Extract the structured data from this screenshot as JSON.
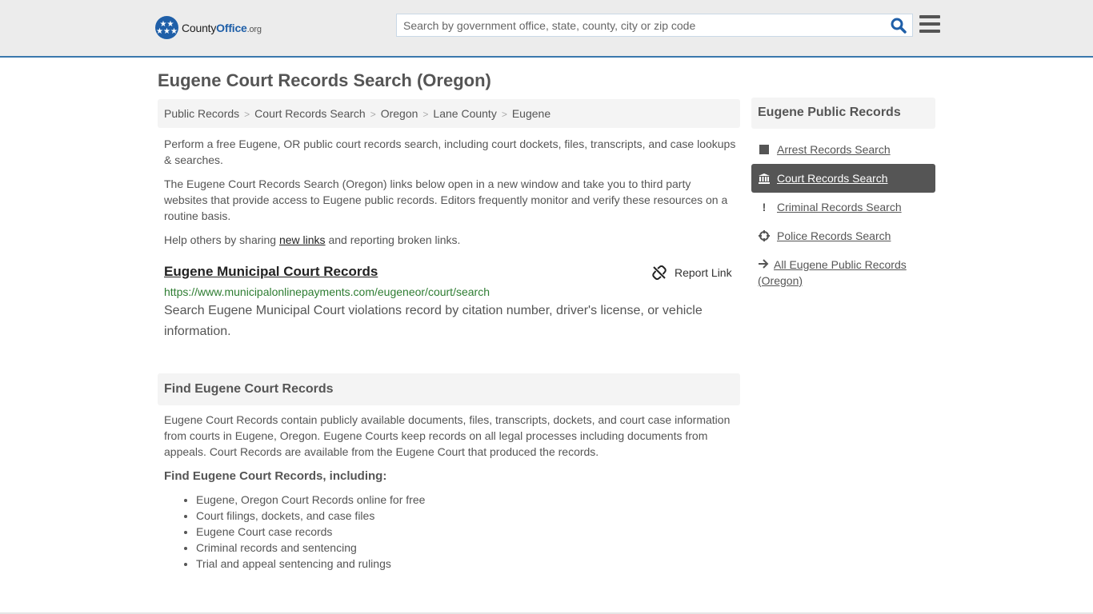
{
  "header": {
    "logo": {
      "part1": "County",
      "part2": "Office",
      "part3": ".org"
    },
    "search_placeholder": "Search by government office, state, county, city or zip code",
    "search_value": "",
    "search_icon": "search-icon",
    "menu_icon": "hamburger-icon",
    "accent_color": "#3b78ad"
  },
  "page": {
    "title": "Eugene Court Records Search (Oregon)",
    "breadcrumb": [
      "Public Records",
      "Court Records Search",
      "Oregon",
      "Lane County",
      "Eugene"
    ],
    "intro_1": "Perform a free Eugene, OR public court records search, including court dockets, files, transcripts, and case lookups & searches.",
    "intro_2": "The Eugene Court Records Search (Oregon) links below open in a new window and take you to third party websites that provide access to Eugene public records. Editors frequently monitor and verify these resources on a routine basis.",
    "intro_3_before": "Help others by sharing ",
    "intro_3_link": "new links",
    "intro_3_after": " and reporting broken links."
  },
  "links": [
    {
      "title": "Eugene Municipal Court Records",
      "url": "https://www.municipalonlinepayments.com/eugeneor/court/search",
      "description": "Search Eugene Municipal Court violations record by citation number, driver's license, or vehicle information.",
      "report_label": "Report Link"
    }
  ],
  "find_section": {
    "heading": "Find Eugene Court Records",
    "body": "Eugene Court Records contain publicly available documents, files, transcripts, dockets, and court case information from courts in Eugene, Oregon. Eugene Courts keep records on all legal processes including documents from appeals. Court Records are available from the Eugene Court that produced the records.",
    "subheading": "Find Eugene Court Records, including:",
    "bullets": [
      "Eugene, Oregon Court Records online for free",
      "Court filings, dockets, and case files",
      "Eugene Court case records",
      "Criminal records and sentencing",
      "Trial and appeal sentencing and rulings"
    ]
  },
  "sidebar": {
    "heading": "Eugene Public Records",
    "items": [
      {
        "label": "Arrest Records Search",
        "icon": "square-icon",
        "active": false
      },
      {
        "label": "Court Records Search",
        "icon": "courthouse-icon",
        "active": true
      },
      {
        "label": "Criminal Records Search",
        "icon": "exclamation-icon",
        "active": false
      },
      {
        "label": "Police Records Search",
        "icon": "crosshair-icon",
        "active": false
      },
      {
        "label": "All Eugene Public Records (Oregon)",
        "icon": "arrow-right-icon",
        "active": false
      }
    ]
  }
}
